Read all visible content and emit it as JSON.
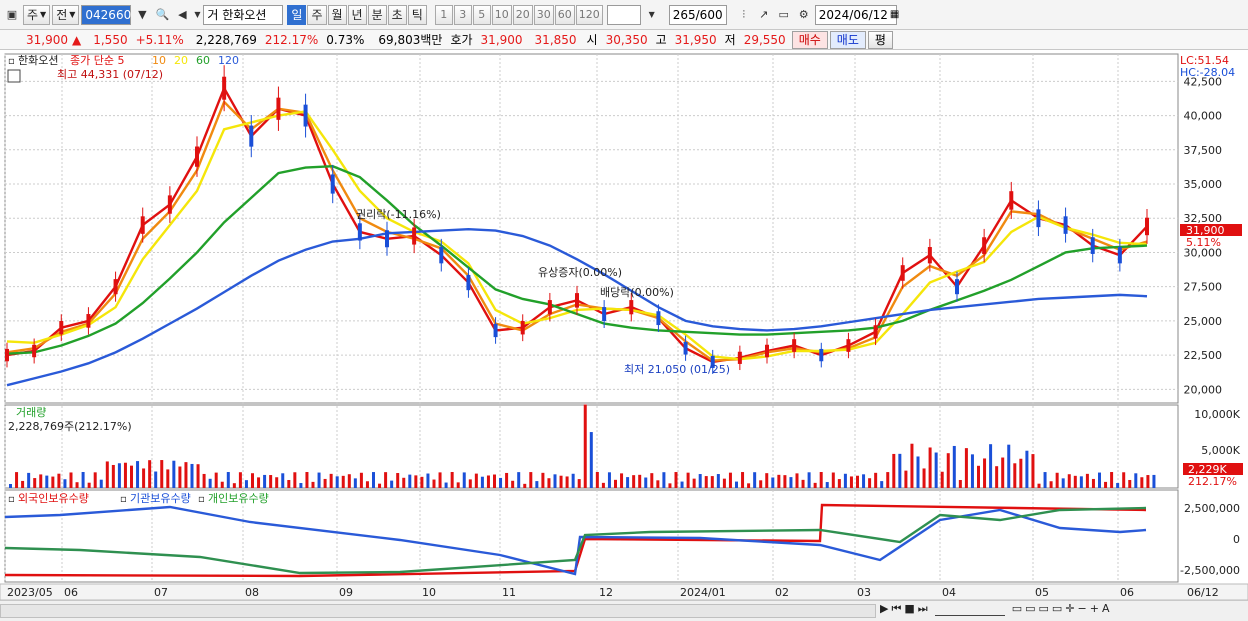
{
  "toolbar": {
    "mode1": "주",
    "mode2": "전",
    "code": "042660",
    "type": "거",
    "name": "한화오션",
    "periods": [
      "일",
      "주",
      "월",
      "년",
      "분",
      "초",
      "틱"
    ],
    "active_period": "일",
    "nums": [
      "1",
      "3",
      "5",
      "10",
      "20",
      "30",
      "60",
      "120"
    ],
    "count": "265",
    "count_total": "/600",
    "date": "2024/06/12"
  },
  "quote": {
    "price": "31,900",
    "change": "1,550",
    "rate": "+5.11%",
    "volume": "2,228,769",
    "vol_rate": "212.17%",
    "turnover": "0.73%",
    "amount": "69,803백만",
    "bid_label": "호가",
    "ask": "31,900",
    "bid": "31,850",
    "open_label": "시",
    "open": "30,350",
    "high_label": "고",
    "high": "31,950",
    "low_label": "저",
    "low": "29,550",
    "buy": "매수",
    "sell": "매도",
    "avg": "평"
  },
  "chart": {
    "legend_name": "한화오션",
    "legend_ma": "종가 단순 5",
    "ma": [
      "10",
      "20",
      "60",
      "120"
    ],
    "high_note": "최고 44,331 (07/12)",
    "low_note": "최저 21,050 (01/25)",
    "ann1": "권리락(-11.16%)",
    "ann2": "유상증자(0.00%)",
    "ann3": "배당락(0.00%)",
    "lc": "LC:51.54",
    "hc": "HC:-28.04",
    "price_tag": "31,900",
    "rate_tag": "5.11%",
    "vol_title": "거래량",
    "vol_value": "2,228,769주(212.17%)",
    "vol_tag": "2,229K",
    "vol_rate_tag": "212.17%",
    "ind1": "외국인보유수량",
    "ind2": "기관보유수량",
    "ind3": "개인보유수량"
  },
  "chart_data": {
    "type": "line",
    "title": "한화오션",
    "x_ticks": [
      "2023/05",
      "06",
      "07",
      "08",
      "09",
      "10",
      "11",
      "12",
      "2024/01",
      "02",
      "03",
      "04",
      "05",
      "06",
      "06/12"
    ],
    "y_ticks": [
      "42,500",
      "40,000",
      "37,500",
      "35,000",
      "32,500",
      "30,000",
      "27,500",
      "25,000",
      "22,500",
      "20,000"
    ],
    "ylim": [
      19000,
      44500
    ],
    "vol_ticks": [
      "10,000K",
      "5,000K"
    ],
    "ind_ticks": [
      "2,500,000",
      "0",
      "-2,500,000"
    ],
    "series": [
      {
        "name": "5",
        "color": "#e01010",
        "values": [
          22500,
          22800,
          24500,
          25000,
          27500,
          32000,
          33500,
          37000,
          42000,
          38500,
          40500,
          40000,
          35000,
          31500,
          31000,
          31200,
          29800,
          27800,
          24300,
          24500,
          26000,
          26500,
          25500,
          26000,
          25200,
          23000,
          22000,
          22300,
          22800,
          23200,
          22500,
          23200,
          24200,
          28500,
          29800,
          27500,
          30500,
          33800,
          32500,
          32000,
          30500,
          29800,
          31900
        ]
      },
      {
        "name": "10",
        "color": "#f08a10",
        "values": [
          22700,
          23000,
          24200,
          24800,
          27000,
          31000,
          33000,
          36000,
          41000,
          39000,
          40500,
          40200,
          36000,
          32500,
          31500,
          31000,
          30300,
          28300,
          24800,
          24300,
          25500,
          26200,
          25900,
          25800,
          25200,
          23500,
          22100,
          22200,
          22700,
          23000,
          22700,
          23000,
          23800,
          27500,
          29000,
          28300,
          29800,
          33000,
          32800,
          31800,
          31000,
          30200,
          30800
        ]
      },
      {
        "name": "20",
        "color": "#f5e60a",
        "values": [
          23500,
          23400,
          24000,
          24700,
          26000,
          29500,
          32000,
          34500,
          39000,
          39500,
          40000,
          40300,
          37500,
          34500,
          32500,
          31500,
          30800,
          29200,
          25800,
          24800,
          25200,
          25800,
          25900,
          25800,
          25400,
          24000,
          22400,
          22200,
          22400,
          22800,
          22800,
          22900,
          23400,
          25500,
          27800,
          28600,
          29300,
          31500,
          32600,
          31800,
          31300,
          30700,
          30600
        ]
      },
      {
        "name": "60",
        "color": "#22a02a",
        "values": [
          22600,
          22700,
          23200,
          23900,
          24800,
          26300,
          28100,
          30000,
          32200,
          34000,
          35800,
          36200,
          36300,
          35500,
          33800,
          32000,
          30500,
          28900,
          27300,
          26600,
          26200,
          25500,
          24800,
          24500,
          24300,
          24200,
          24100,
          24000,
          24000,
          24100,
          24200,
          24300,
          24500,
          25000,
          25800,
          26500,
          27200,
          28000,
          29000,
          30000,
          30300,
          30400,
          30500
        ]
      },
      {
        "name": "120",
        "color": "#2a5ad8",
        "values": [
          20300,
          20800,
          21300,
          21900,
          22700,
          23700,
          24800,
          25900,
          27100,
          28300,
          29400,
          30200,
          30800,
          31000,
          31400,
          31500,
          31600,
          31700,
          31600,
          31200,
          30500,
          29500,
          28400,
          27200,
          26000,
          25000,
          24600,
          24400,
          24300,
          24400,
          24600,
          24900,
          25200,
          25500,
          25800,
          26000,
          26200,
          26400,
          26600,
          26700,
          26800,
          26900,
          26800
        ]
      }
    ]
  }
}
